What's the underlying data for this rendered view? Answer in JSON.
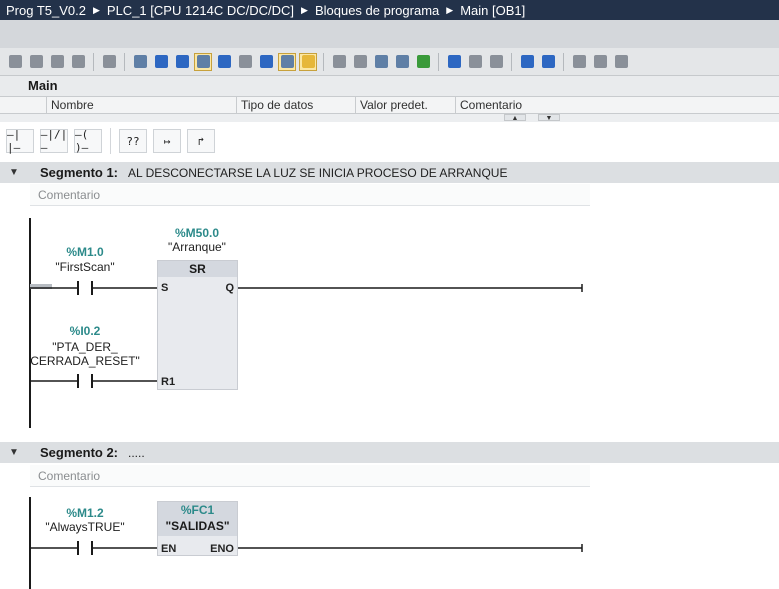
{
  "titlebar": {
    "crumbs": [
      "Prog T5_V0.2",
      "PLC_1 [CPU 1214C DC/DC/DC]",
      "Bloques de programa",
      "Main [OB1]"
    ]
  },
  "block": {
    "name": "Main",
    "columns": [
      "Nombre",
      "Tipo de datos",
      "Valor predet.",
      "Comentario"
    ]
  },
  "palette": {
    "items": [
      "—| |—",
      "—|/|—",
      "—( )—",
      "??",
      "↦",
      "↱"
    ]
  },
  "networks": [
    {
      "title": "Segmento 1:",
      "comment": "AL DESCONECTARSE LA LUZ SE INICIA PROCESO DE ARRANQUE",
      "comment_placeholder": "Comentario",
      "box_address": "%M50.0",
      "box_symbol": "\"Arranque\"",
      "box_type": "SR",
      "pins": {
        "s": "S",
        "q": "Q",
        "r1": "R1"
      },
      "contact1_address": "%M1.0",
      "contact1_symbol": "\"FirstScan\"",
      "contact2_address": "%I0.2",
      "contact2_symbol_line1": "\"PTA_DER_",
      "contact2_symbol_line2": "CERRADA_RESET\""
    },
    {
      "title": "Segmento 2:",
      "comment": ".....",
      "comment_placeholder": "Comentario",
      "box_address": "%FC1",
      "box_symbol": "\"SALIDAS\"",
      "pins": {
        "en": "EN",
        "eno": "ENO"
      },
      "contact1_address": "%M1.2",
      "contact1_symbol": "\"AlwaysTRUE\""
    }
  ],
  "colors": {
    "titlebar": "#23324a",
    "address": "#2c8a8a",
    "segment_header": "#dcdfe2",
    "box": "#e8eaee"
  }
}
